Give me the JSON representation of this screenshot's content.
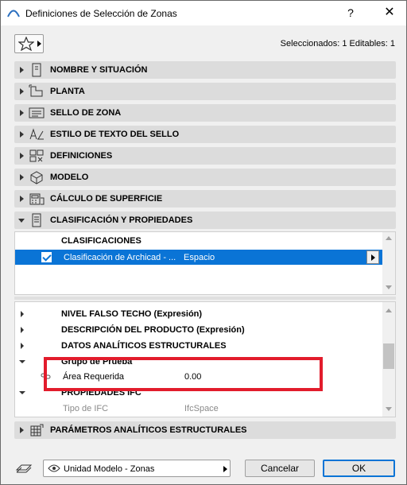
{
  "window": {
    "title": "Definiciones de Selección de Zonas",
    "help": "?",
    "close": "✕"
  },
  "header": {
    "selection_info": "Seleccionados: 1 Editables: 1"
  },
  "panels": [
    {
      "label": "NOMBRE Y SITUACIÓN",
      "icon": "name-location-icon"
    },
    {
      "label": "PLANTA",
      "icon": "floor-plan-icon"
    },
    {
      "label": "SELLO DE ZONA",
      "icon": "zone-stamp-icon"
    },
    {
      "label": "ESTILO DE TEXTO DEL SELLO",
      "icon": "text-style-icon"
    },
    {
      "label": "DEFINICIONES",
      "icon": "definitions-icon"
    },
    {
      "label": "MODELO",
      "icon": "model-icon"
    },
    {
      "label": "CÁLCULO DE SUPERFICIE",
      "icon": "area-calculation-icon"
    },
    {
      "label": "CLASIFICACIÓN Y PROPIEDADES",
      "icon": "classification-icon"
    }
  ],
  "classifications": {
    "header": "CLASIFICACIONES",
    "row": {
      "system": "Clasificación de Archicad - ...",
      "value": "Espacio",
      "checked": true
    }
  },
  "properties": [
    {
      "label": "NIVEL FALSO TECHO (Expresión)"
    },
    {
      "label": "DESCRIPCIÓN DEL PRODUCTO (Expresión)"
    },
    {
      "label": "DATOS ANALÍTICOS ESTRUCTURALES"
    },
    {
      "label": "Grupo de Prueba"
    },
    {
      "label": "Área Requerida",
      "value": "0.00"
    },
    {
      "label": "PROPIEDADES IFC"
    },
    {
      "label": "Tipo de IFC",
      "value": "IfcSpace"
    }
  ],
  "structural_panel": {
    "label": "PARÁMETROS ANALÍTICOS ESTRUCTURALES"
  },
  "footer": {
    "layer_combo": "Unidad Modelo - Zonas",
    "cancel": "Cancelar",
    "ok": "OK"
  },
  "colors": {
    "selection": "#0a74d6",
    "highlight_box": "#e21c2c",
    "panel_bg": "#dcdcdc"
  }
}
